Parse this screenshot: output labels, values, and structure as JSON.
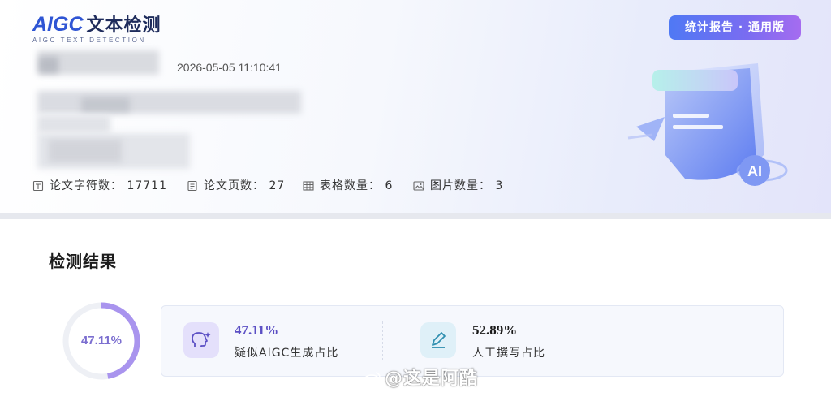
{
  "header": {
    "logo_main": "AIGC",
    "logo_cn": "文本检测",
    "logo_sub": "AIGC TEXT DETECTION",
    "badge": "统计报告 · 通用版",
    "timestamp": "2026-05-05 11:10:41"
  },
  "stats": [
    {
      "label": "论文字符数：",
      "value": "17711",
      "icon": "document-char-icon"
    },
    {
      "label": "论文页数：",
      "value": "27",
      "icon": "pages-icon"
    },
    {
      "label": "表格数量：",
      "value": "6",
      "icon": "table-icon"
    },
    {
      "label": "图片数量：",
      "value": "3",
      "icon": "image-icon"
    }
  ],
  "stats_text": [
    "论文字符数： 17711",
    "论文页数： 27",
    "表格数量： 6",
    "图片数量： 3"
  ],
  "illustration": {
    "ai_label": "AI"
  },
  "result": {
    "title": "检测结果",
    "ring_percent_text": "47.11%",
    "ring_fraction": 0.4711,
    "aigc": {
      "percent": "47.11%",
      "label": "疑似AIGC生成占比",
      "icon": "brain-sparkle-icon"
    },
    "human": {
      "percent": "52.89%",
      "label": "人工撰写占比",
      "icon": "pen-icon"
    }
  },
  "watermark": "@这是阿酷",
  "colors": {
    "brand": "#2f55d4",
    "ring_fill": "#a994ee",
    "ring_track": "#eef0f5",
    "aigc_accent": "#5b4fc4",
    "human_accent": "#1a1a1a"
  }
}
